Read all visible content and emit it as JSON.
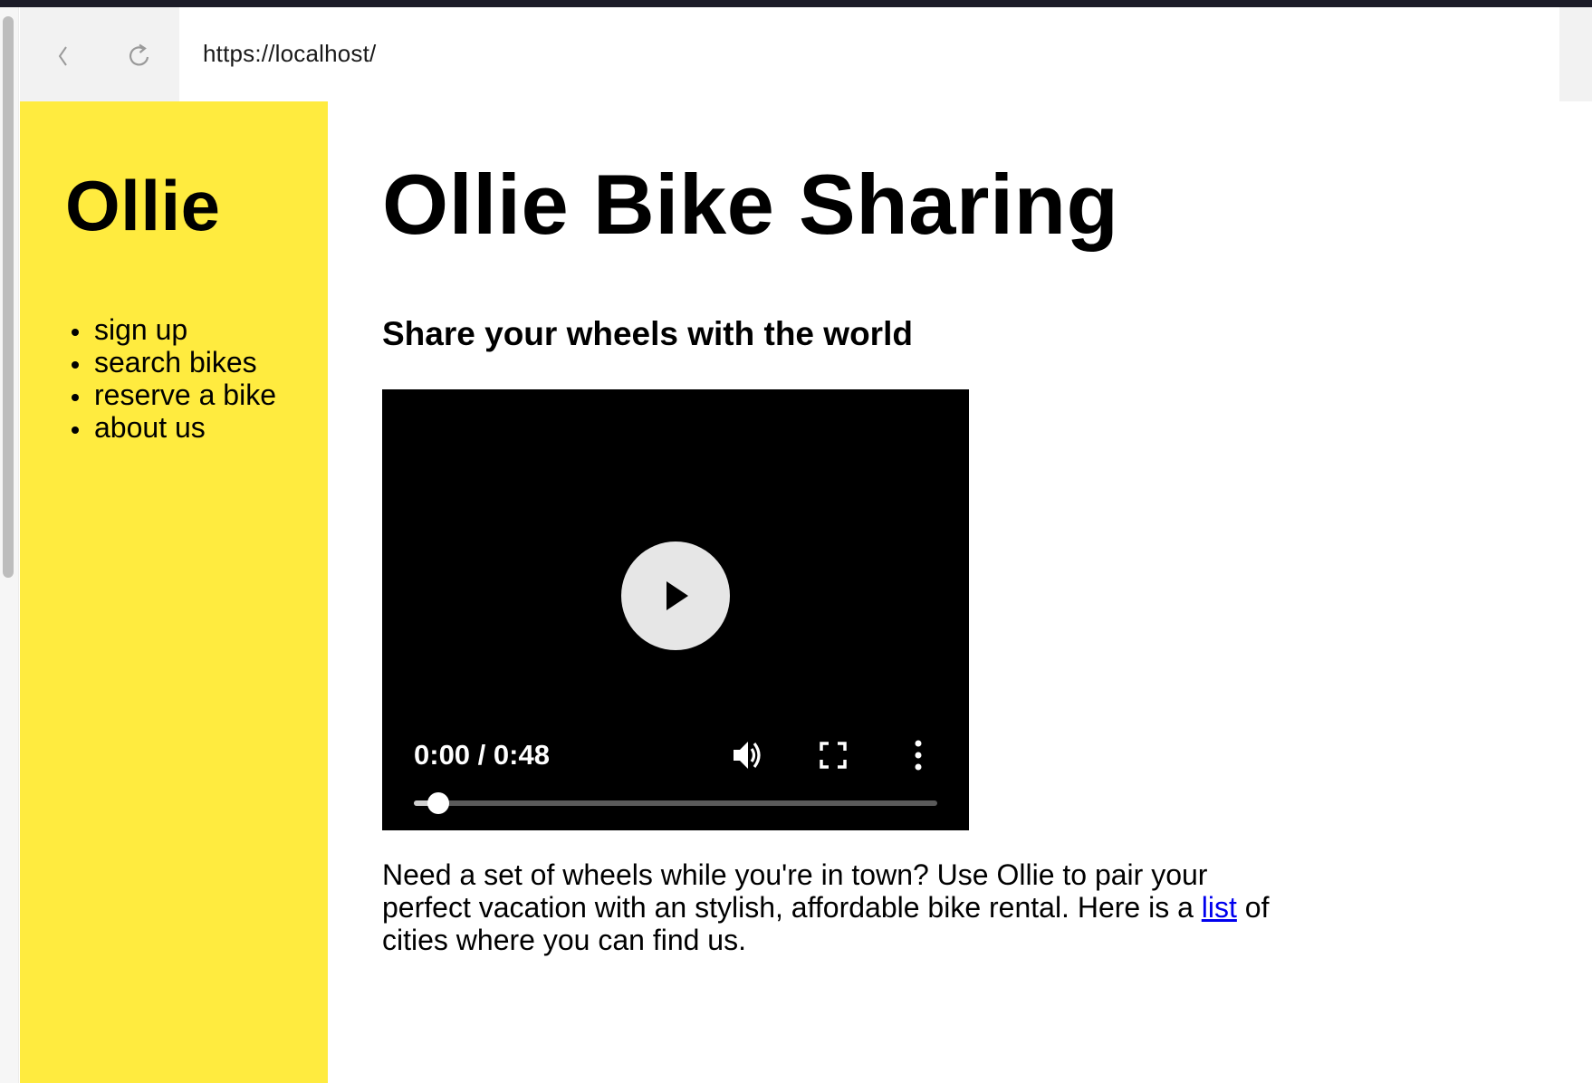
{
  "browser": {
    "url": "https://localhost/"
  },
  "sidebar": {
    "logo": "Ollie",
    "nav_items": [
      {
        "label": "sign up"
      },
      {
        "label": "search bikes"
      },
      {
        "label": "reserve a bike"
      },
      {
        "label": "about us"
      }
    ]
  },
  "main": {
    "title": "Ollie Bike Sharing",
    "subtitle": "Share your wheels with the world",
    "video": {
      "time_display": "0:00 / 0:48",
      "progress": 0.05
    },
    "paragraph": {
      "before": "Need a set of wheels while you're in town? Use Ollie to pair your perfect vacation with an stylish, affordable bike rental. Here is a ",
      "link_text": "list",
      "after": " of cities where you can find us."
    }
  },
  "colors": {
    "sidebar_bg": "#ffeb3f",
    "link": "#0000ee",
    "video_bg": "#000000"
  }
}
